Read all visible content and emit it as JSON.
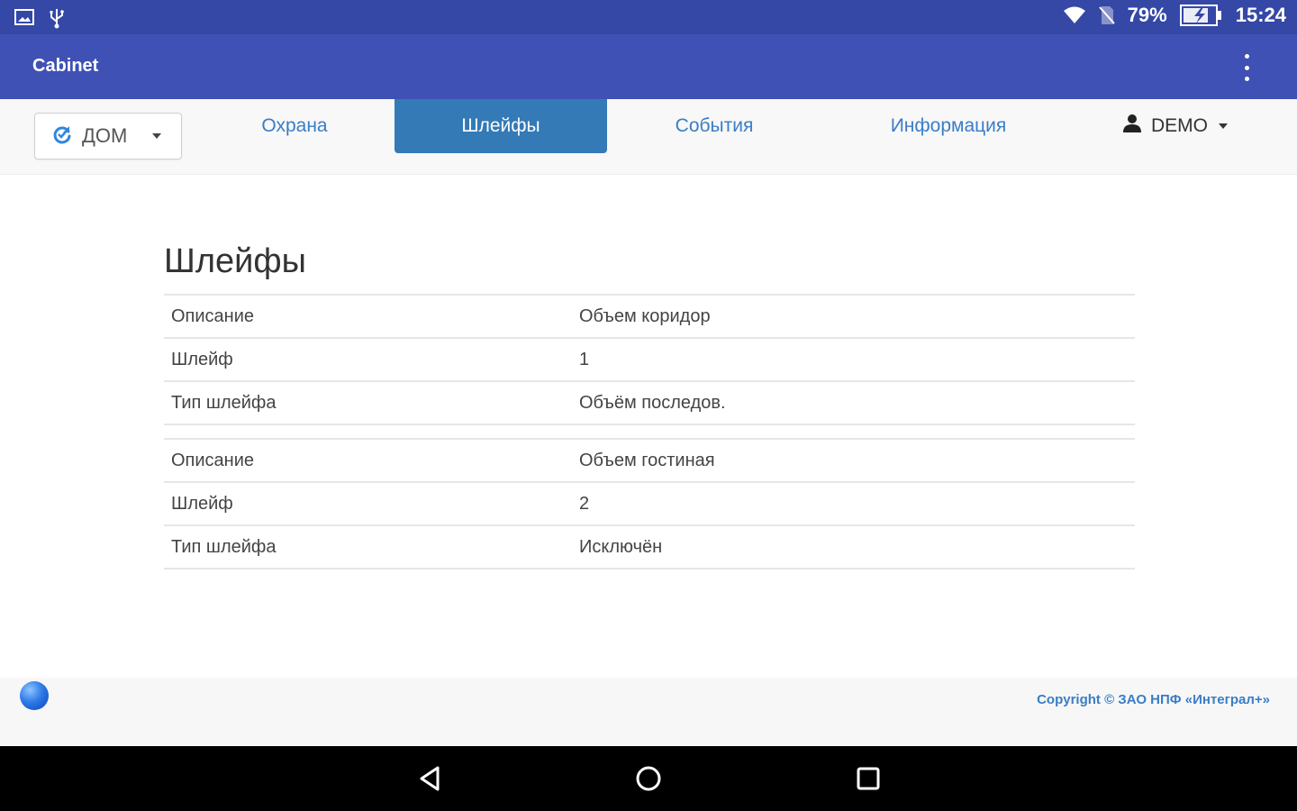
{
  "status_bar": {
    "left_icons": [
      "image-icon",
      "usb-icon"
    ],
    "right_icons": [
      "wifi-icon",
      "no-sim-icon",
      "battery-charging-icon"
    ],
    "battery": "79%",
    "time": "15:24"
  },
  "appbar": {
    "title": "Cabinet",
    "menu_icon": "more-vert-icon"
  },
  "navbar": {
    "site_select": {
      "value": "ДОМ",
      "icon": "refresh-icon"
    },
    "tabs": [
      {
        "label": "Охрана",
        "active": false
      },
      {
        "label": "Шлейфы",
        "active": true
      },
      {
        "label": "События",
        "active": false
      },
      {
        "label": "Информация",
        "active": false
      }
    ],
    "user": {
      "label": "DEMO",
      "icon": "user-icon"
    }
  },
  "main": {
    "heading": "Шлейфы",
    "zones": [
      {
        "rows": [
          {
            "label": "Описание",
            "value": "Объем коридор"
          },
          {
            "label": "Шлейф",
            "value": "1"
          },
          {
            "label": "Тип шлейфа",
            "value": "Объём последов."
          }
        ]
      },
      {
        "rows": [
          {
            "label": "Описание",
            "value": "Объем гостиная"
          },
          {
            "label": "Шлейф",
            "value": "2"
          },
          {
            "label": "Тип шлейфа",
            "value": "Исключён"
          }
        ]
      }
    ]
  },
  "footer": {
    "copyright": "Copyright © ЗАО НПФ «Интеграл+»",
    "logo_icon": "globe-icon"
  },
  "system_nav": {
    "buttons": [
      "back-icon",
      "home-icon",
      "recents-icon"
    ]
  },
  "colors": {
    "status_bar": "#3548a6",
    "app_bar": "#3f51b5",
    "active_tab": "#337ab7",
    "link": "#3a7dc6"
  }
}
